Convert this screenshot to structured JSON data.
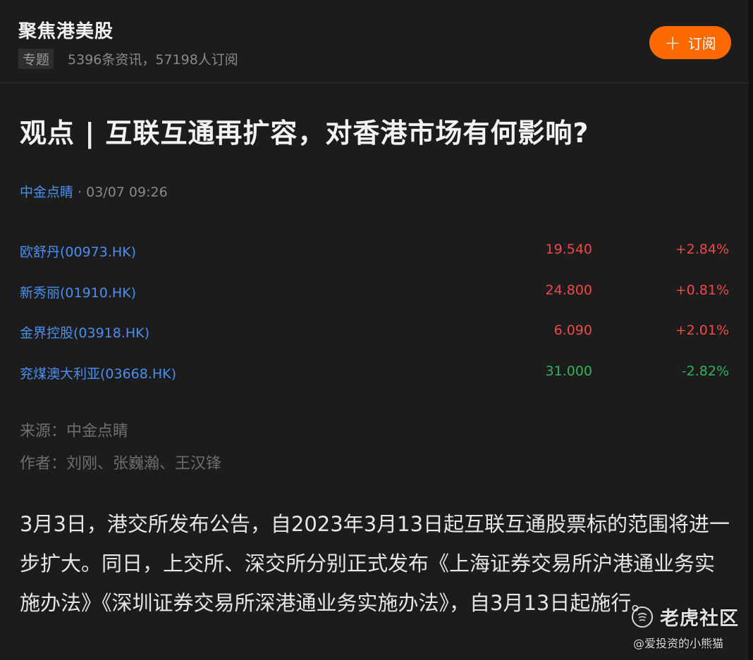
{
  "topic": {
    "title": "聚焦港美股",
    "tag": "专题",
    "stats": "5396条资讯，57198人订阅",
    "subscribe_icon": "+",
    "subscribe_label": "订阅"
  },
  "article": {
    "title": "观点 | 互联互通再扩容，对香港市场有何影响?",
    "author": "中金点睛",
    "time": " · 03/07 09:26",
    "source": "来源：中金点睛",
    "authors_line": "作者：刘刚、张巍瀚、王汉锋",
    "body": "3月3日，港交所发布公告，自2023年3月13日起互联互通股票标的范围将进一步扩大。同日，上交所、深交所分别正式发布《上海证券交易所沪港通业务实施办法》《深圳证券交易所深港通业务实施办法》，自3月13日起施行。"
  },
  "stocks": [
    {
      "name": "欧舒丹(00973.HK)",
      "price": "19.540",
      "change": "+2.84%",
      "direction": "up"
    },
    {
      "name": "新秀丽(01910.HK)",
      "price": "24.800",
      "change": "+0.81%",
      "direction": "up"
    },
    {
      "name": "金界控股(03918.HK)",
      "price": "6.090",
      "change": "+2.01%",
      "direction": "up"
    },
    {
      "name": "兖煤澳大利亚(03668.HK)",
      "price": "31.000",
      "change": "-2.82%",
      "direction": "down"
    }
  ],
  "watermark": {
    "brand": "老虎社区",
    "handle": "@爱投资的小熊猫",
    "logo_icon": "tiger-logo-icon"
  },
  "colors": {
    "accent": "#ff6a00",
    "link": "#4a8ff0",
    "up": "#f04848",
    "down": "#2fb45a"
  }
}
